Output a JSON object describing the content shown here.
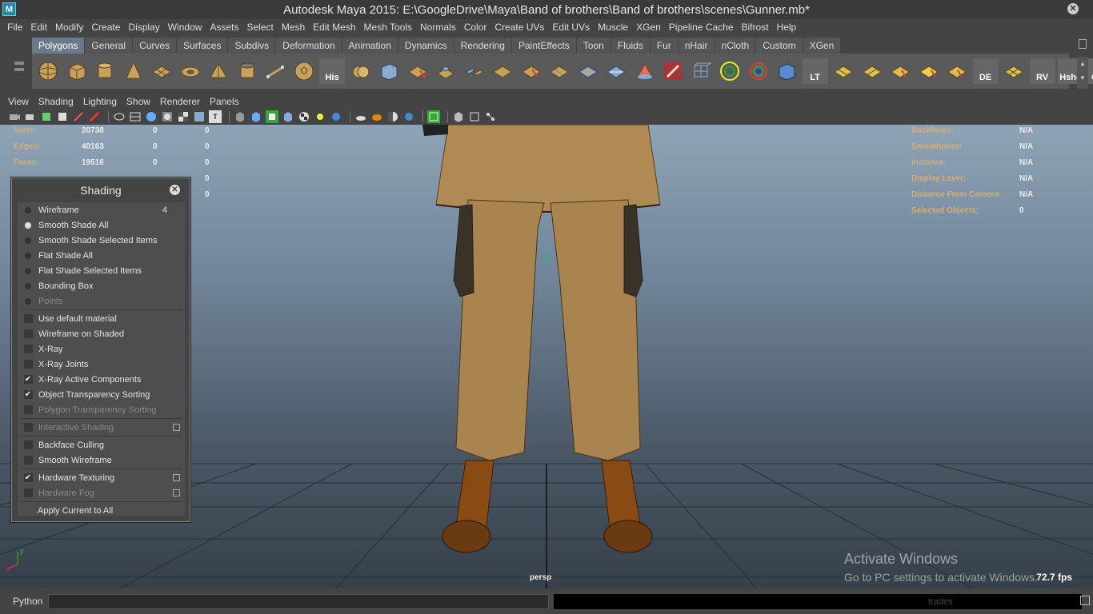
{
  "window": {
    "title": "Autodesk Maya 2015: E:\\GoogleDrive\\Maya\\Band of brothers\\Band of brothers\\scenes\\Gunner.mb*"
  },
  "menubar": [
    "File",
    "Edit",
    "Modify",
    "Create",
    "Display",
    "Window",
    "Assets",
    "Select",
    "Mesh",
    "Edit Mesh",
    "Mesh Tools",
    "Normals",
    "Color",
    "Create UVs",
    "Edit UVs",
    "Muscle",
    "XGen",
    "Pipeline Cache",
    "Bifrost",
    "Help"
  ],
  "shelf": {
    "tabs": [
      "Polygons",
      "General",
      "Curves",
      "Surfaces",
      "Subdivs",
      "Deformation",
      "Animation",
      "Dynamics",
      "Rendering",
      "PaintEffects",
      "Toon",
      "Fluids",
      "Fur",
      "nHair",
      "nCloth",
      "Custom",
      "XGen"
    ],
    "active_tab": "Polygons",
    "labels": {
      "his": "His",
      "lt": "LT",
      "de": "DE",
      "rv": "RV",
      "hshd": "Hshd",
      "out": "Out"
    }
  },
  "panel_menu": [
    "View",
    "Shading",
    "Lighting",
    "Show",
    "Renderer",
    "Panels"
  ],
  "hud": {
    "left": [
      {
        "label": "Verts:",
        "v1": "20738",
        "v2": "0",
        "v3": "0"
      },
      {
        "label": "Edges:",
        "v1": "40163",
        "v2": "0",
        "v3": "0"
      },
      {
        "label": "Faces:",
        "v1": "19516",
        "v2": "0",
        "v3": "0"
      },
      {
        "label": "",
        "v1": "",
        "v2": "",
        "v3": "0"
      },
      {
        "label": "",
        "v1": "",
        "v2": "",
        "v3": "0"
      }
    ],
    "right": [
      {
        "label": "Backfaces:",
        "value": "N/A"
      },
      {
        "label": "Smoothness:",
        "value": "N/A"
      },
      {
        "label": "Instance:",
        "value": "N/A"
      },
      {
        "label": "Display Layer:",
        "value": "N/A"
      },
      {
        "label": "Distance From Camera:",
        "value": "N/A"
      },
      {
        "label": "Selected Objects:",
        "value": "0"
      }
    ],
    "camera": "persp",
    "fps": "72.7 fps",
    "axis_y": "y",
    "axis_x": "x"
  },
  "watermark": {
    "line1": "Activate Windows",
    "line2": "Go to PC settings to activate Windows."
  },
  "shading_menu": {
    "title": "Shading",
    "wireframe": "Wireframe",
    "wireframe_key": "4",
    "smooth_all": "Smooth Shade All",
    "smooth_selected": "Smooth Shade Selected Items",
    "flat_all": "Flat Shade All",
    "flat_selected": "Flat Shade Selected Items",
    "bounding_box": "Bounding Box",
    "points": "Points",
    "use_default_material": "Use default material",
    "wireframe_on_shaded": "Wireframe on Shaded",
    "xray": "X-Ray",
    "xray_joints": "X-Ray Joints",
    "xray_active": "X-Ray Active Components",
    "obj_transparency": "Object Transparency Sorting",
    "poly_transparency": "Polygon Transparency Sorting",
    "interactive_shading": "Interactive Shading",
    "backface_culling": "Backface Culling",
    "smooth_wireframe": "Smooth Wireframe",
    "hardware_texturing": "Hardware Texturing",
    "hardware_fog": "Hardware Fog",
    "apply_all": "Apply Current to All"
  },
  "cmdline": {
    "label": "Python",
    "trades": "trades"
  }
}
